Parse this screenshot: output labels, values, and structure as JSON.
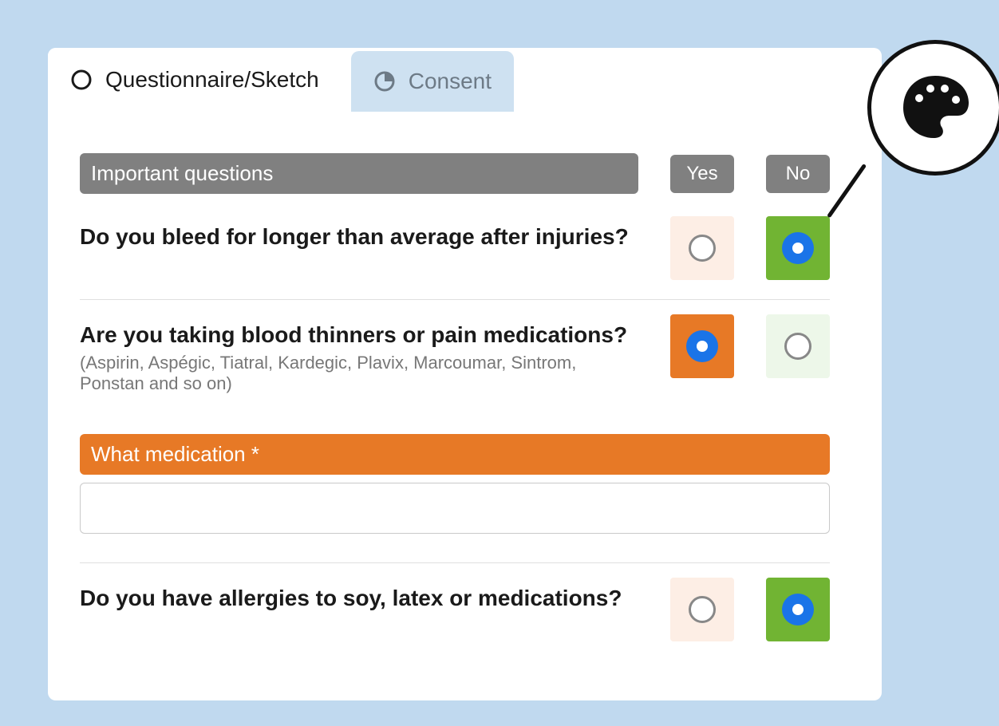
{
  "tabs": [
    {
      "label": "Questionnaire/Sketch",
      "active": true
    },
    {
      "label": "Consent",
      "active": false
    }
  ],
  "section_header": "Important questions",
  "column_headers": {
    "yes": "Yes",
    "no": "No"
  },
  "questions": [
    {
      "text": "Do you bleed for longer than average after injuries?",
      "subtext": "",
      "answer": "no"
    },
    {
      "text": "Are you taking blood thinners or pain medications?",
      "subtext": "(Aspirin, Aspégic, Tiatral, Kardegic, Plavix, Marcoumar, Sintrom, Ponstan and so on)",
      "answer": "yes"
    },
    {
      "text": "Do you have allergies to soy, latex or medications?",
      "subtext": "",
      "answer": "no"
    }
  ],
  "followup": {
    "label": "What medication *",
    "value": ""
  },
  "colors": {
    "page_bg": "#c0d9ef",
    "accent_orange": "#e77926",
    "accent_green": "#71b433",
    "header_gray": "#808080",
    "radio_blue": "#1a74e8"
  }
}
